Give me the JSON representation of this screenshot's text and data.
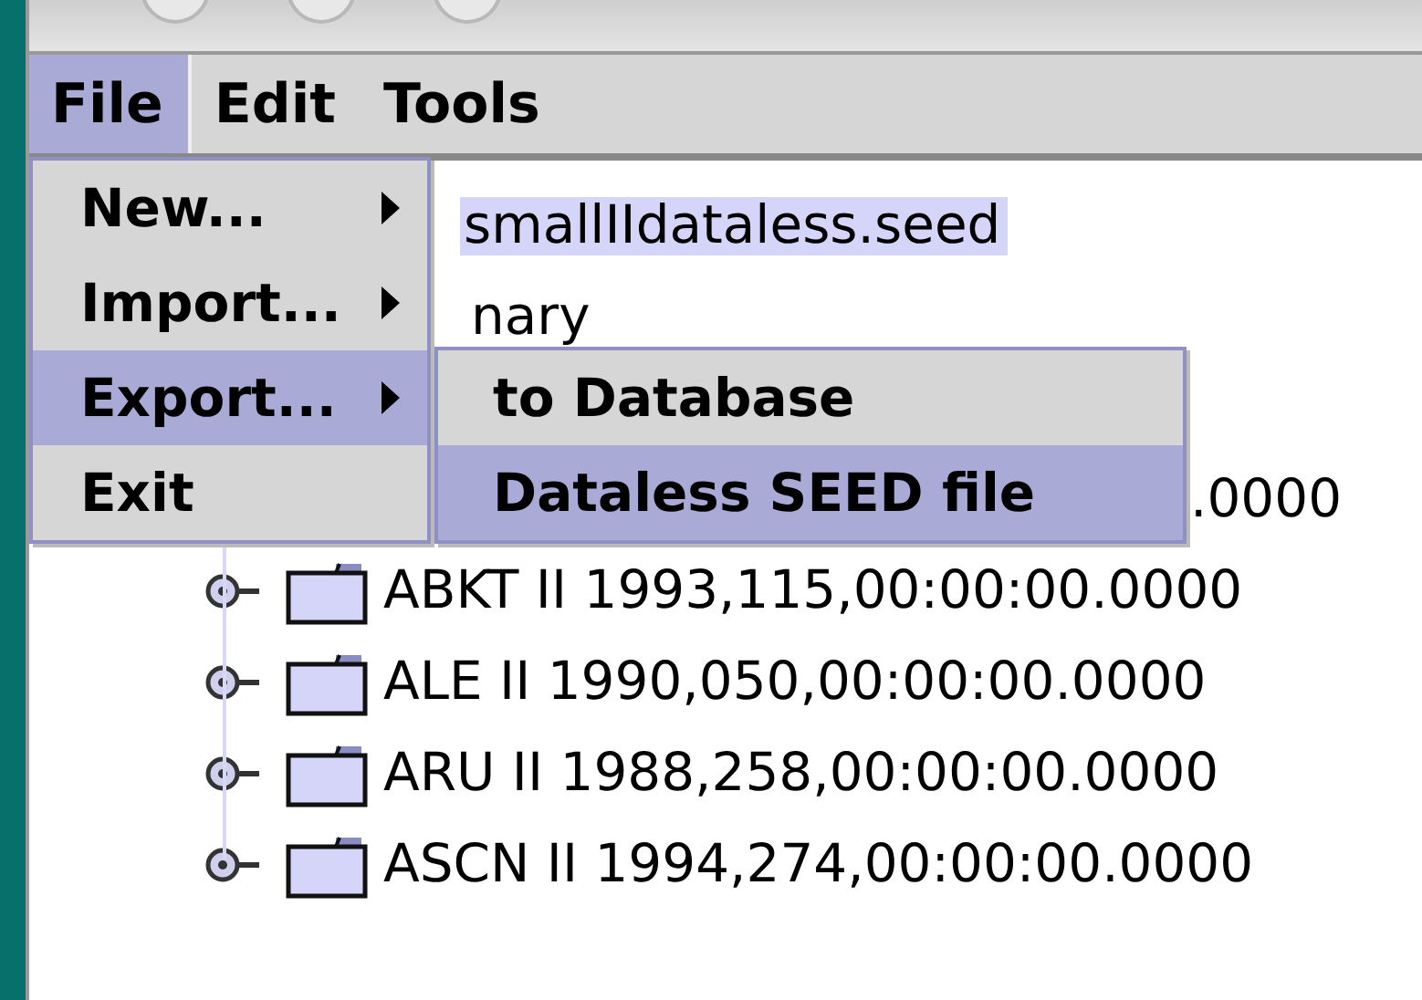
{
  "menu_bar": [
    {
      "label": "File",
      "selected": true
    },
    {
      "label": "Edit",
      "selected": false
    },
    {
      "label": "Tools",
      "selected": false
    }
  ],
  "file_menu": [
    {
      "label": "New...",
      "submenu": true,
      "selected": false
    },
    {
      "label": "Import...",
      "submenu": true,
      "selected": false
    },
    {
      "label": "Export...",
      "submenu": true,
      "selected": true
    },
    {
      "label": "Exit",
      "submenu": false,
      "selected": false
    }
  ],
  "export_submenu": [
    {
      "label": "to Database",
      "selected": false
    },
    {
      "label": "Dataless SEED file",
      "selected": true
    }
  ],
  "tree": [
    {
      "kind": "root",
      "label": "smallIIdataless.seed",
      "selected": true
    },
    {
      "kind": "branch",
      "label": "nary",
      "selected": false
    },
    {
      "kind": "tail",
      "label": ".0000",
      "selected": false
    },
    {
      "kind": "station",
      "label": "ABKT II 1993,115,00:00:00.0000",
      "selected": false
    },
    {
      "kind": "station",
      "label": "ALE II 1990,050,00:00:00.0000",
      "selected": false
    },
    {
      "kind": "station",
      "label": "ARU II 1988,258,00:00:00.0000",
      "selected": false
    },
    {
      "kind": "station",
      "label": "ASCN II 1994,274,00:00:00.0000",
      "selected": false
    }
  ]
}
